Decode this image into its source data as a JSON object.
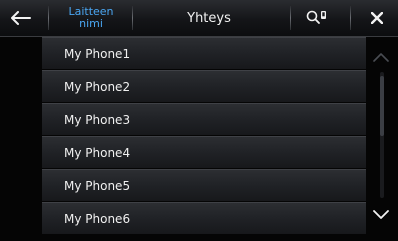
{
  "header": {
    "back_icon": "arrow-left-icon",
    "tab_device_name_line1": "Laitteen",
    "tab_device_name_line2": "nimi",
    "tab_connection": "Yhteys",
    "search_icon": "search-device-icon",
    "close_icon": "close-icon",
    "active_color": "#4aa6f2"
  },
  "devices": [
    {
      "name": "My Phone1"
    },
    {
      "name": "My Phone2"
    },
    {
      "name": "My Phone3"
    },
    {
      "name": "My Phone4"
    },
    {
      "name": "My Phone5"
    },
    {
      "name": "My Phone6"
    }
  ],
  "scroll": {
    "up_icon": "chevron-up-icon",
    "down_icon": "chevron-down-icon"
  }
}
